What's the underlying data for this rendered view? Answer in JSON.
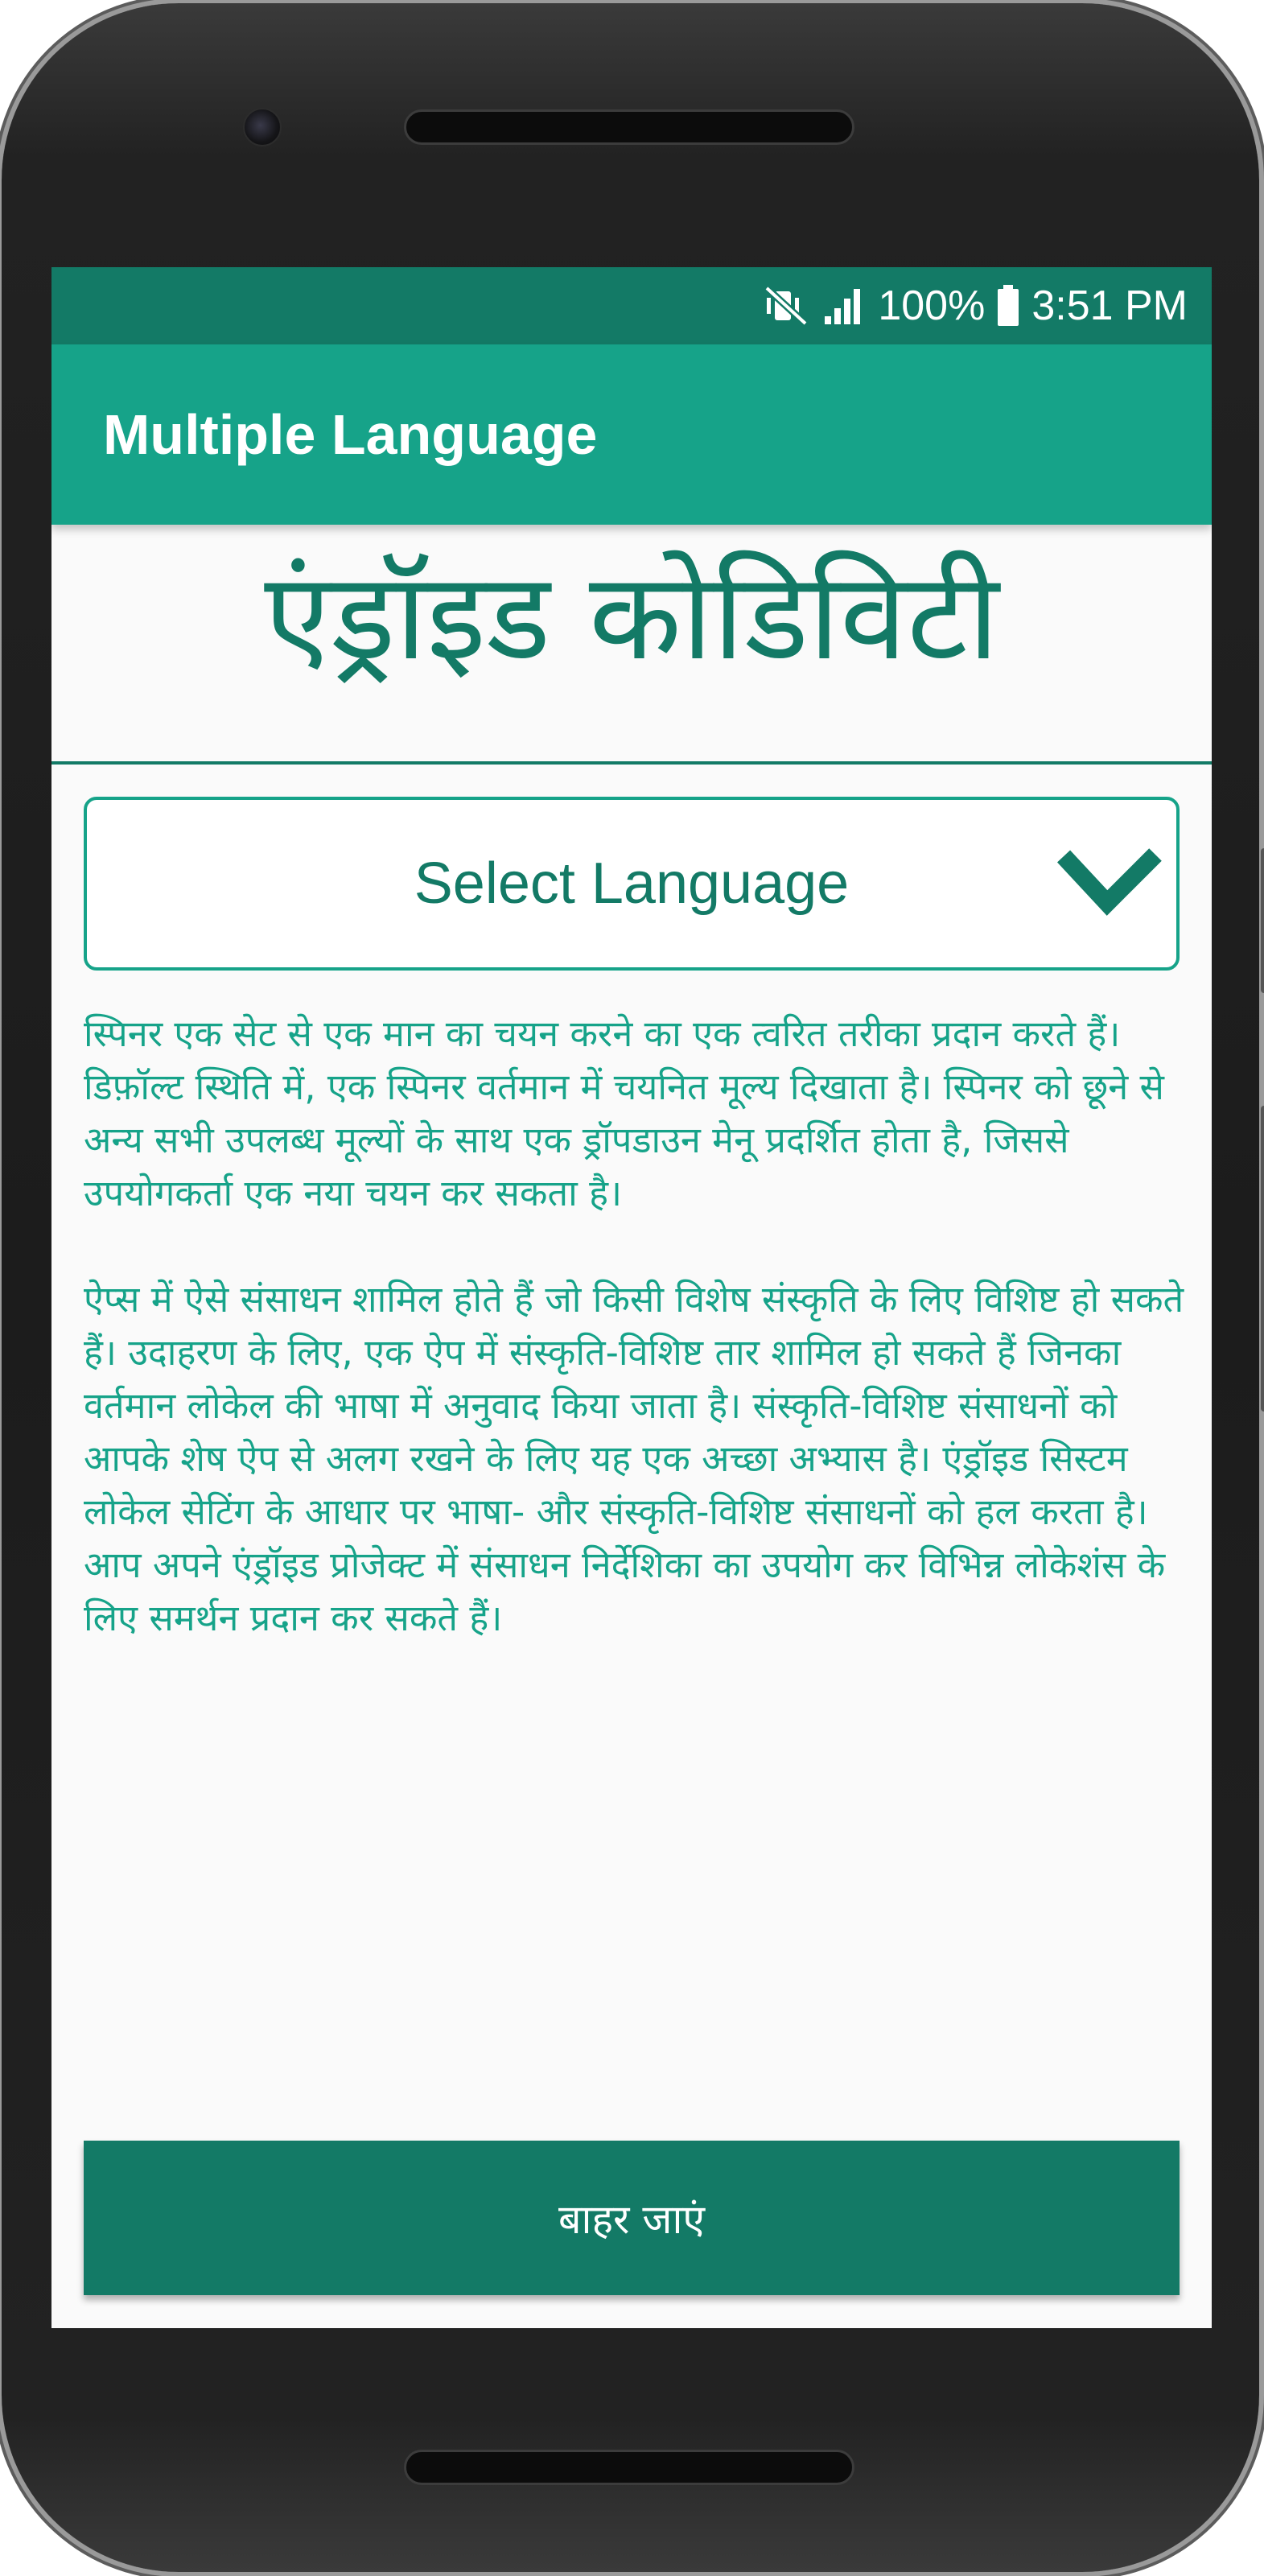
{
  "status_bar": {
    "battery": "100%",
    "time": "3:51 PM",
    "icons": [
      "vibrate-off-icon",
      "signal-icon",
      "battery-icon"
    ]
  },
  "app_bar": {
    "title": "Multiple Language"
  },
  "main": {
    "heading": "एंड्रॉइड कोडिविटी",
    "spinner": {
      "selected": "Select Language",
      "icon": "chevron-down-icon"
    },
    "paragraph_1": "स्पिनर एक सेट से एक मान का चयन करने का एक त्वरित तरीका प्रदान करते हैं। डिफ़ॉल्ट स्थिति में, एक स्पिनर वर्तमान में चयनित मूल्य दिखाता है। स्पिनर को छूने से अन्य सभी उपलब्ध मूल्यों के साथ एक ड्रॉपडाउन मेनू प्रदर्शित होता है, जिससे उपयोगकर्ता एक नया चयन कर सकता है।",
    "paragraph_2": "ऐप्स में ऐसे संसाधन शामिल होते हैं जो किसी विशेष संस्कृति के लिए विशिष्ट हो सकते हैं। उदाहरण के लिए, एक ऐप में संस्कृति-विशिष्ट तार शामिल हो सकते हैं जिनका वर्तमान लोकेल की भाषा में अनुवाद किया जाता है। संस्कृति-विशिष्ट संसाधनों को आपके शेष ऐप से अलग रखने के लिए यह एक अच्छा अभ्यास है। एंड्रॉइड सिस्टम लोकेल सेटिंग के आधार पर भाषा- और संस्कृति-विशिष्ट संसाधनों को हल करता है। आप अपने एंड्रॉइड प्रोजेक्ट में संसाधन निर्देशिका का उपयोग कर विभिन्न लोकेशंस के लिए समर्थन प्रदान कर सकते हैं।",
    "exit_button": "बाहर जाएं"
  },
  "colors": {
    "primary": "#16a389",
    "primary_dark": "#137a66",
    "background": "#fafafa"
  }
}
